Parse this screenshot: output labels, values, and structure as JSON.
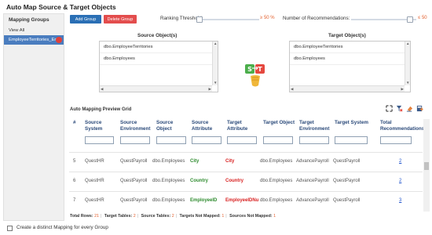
{
  "title": "Auto Map Source & Target Objects",
  "sidebar": {
    "header": "Mapping Groups",
    "items": [
      "View All",
      "EmployeeTerritories_Em..."
    ]
  },
  "toolbar": {
    "add_label": "Add Group",
    "delete_label": "Delete Group",
    "ranking_label": "Ranking Threshold:",
    "ranking_value": "≥ 50 %",
    "ranking_level": 0.0,
    "reco_label": "Number of Recommendations:",
    "reco_value": "≤ 50",
    "reco_level": 0.95
  },
  "source": {
    "title": "Source Object(s)",
    "items": [
      "dbo.EmployeeTerritories",
      "dbo.Employees"
    ]
  },
  "target": {
    "title": "Target Object(s)",
    "items": [
      "dbo.EmployeeTerritories",
      "dbo.Employees"
    ]
  },
  "grid": {
    "title": "Auto Mapping Preview Grid",
    "columns": [
      "#",
      "Source System",
      "Source Environment",
      "Source Object",
      "Source Attribute",
      "Target Attribute",
      "Target Object",
      "Target Environment",
      "Target System",
      "Total Recommendations"
    ],
    "rows": [
      {
        "num": "5",
        "src_sys": "QuestHR",
        "src_env": "QuestPayroll",
        "src_obj": "dbo.Employees",
        "src_attr": "City",
        "tgt_attr": "City",
        "tgt_obj": "dbo.Employees",
        "tgt_env": "AdvancePayroll",
        "tgt_sys": "QuestPayroll",
        "total": "2"
      },
      {
        "num": "6",
        "src_sys": "QuestHR",
        "src_env": "QuestPayroll",
        "src_obj": "dbo.Employees",
        "src_attr": "Country",
        "tgt_attr": "Country",
        "tgt_obj": "dbo.Employees",
        "tgt_env": "AdvancePayroll",
        "tgt_sys": "QuestPayroll",
        "total": "2"
      },
      {
        "num": "7",
        "src_sys": "QuestHR",
        "src_env": "QuestPayroll",
        "src_obj": "dbo.Employees",
        "src_attr": "EmployeeID",
        "tgt_attr": "EmployeeIDNu",
        "tgt_obj": "dbo.Employees",
        "tgt_env": "AdvancePayroll",
        "tgt_sys": "QuestPayroll",
        "total": "3"
      }
    ]
  },
  "footer": {
    "total_rows_label": "Total Rows:",
    "total_rows": "21",
    "target_tables_label": "Target Tables:",
    "target_tables": "2",
    "source_tables_label": "Source Tables:",
    "source_tables": "2",
    "targets_not_mapped_label": "Targets Not Mapped:",
    "targets_not_mapped": "1",
    "sources_not_mapped_label": "Sources Not Mapped:",
    "sources_not_mapped": "1"
  },
  "bottom_checkbox_label": "Create a distinct Mapping for every Group",
  "colors": {
    "accent": "#2a6fb5",
    "danger": "#e34d4d",
    "highlight": "#e45f2c",
    "header_text": "#2b4a7a"
  }
}
